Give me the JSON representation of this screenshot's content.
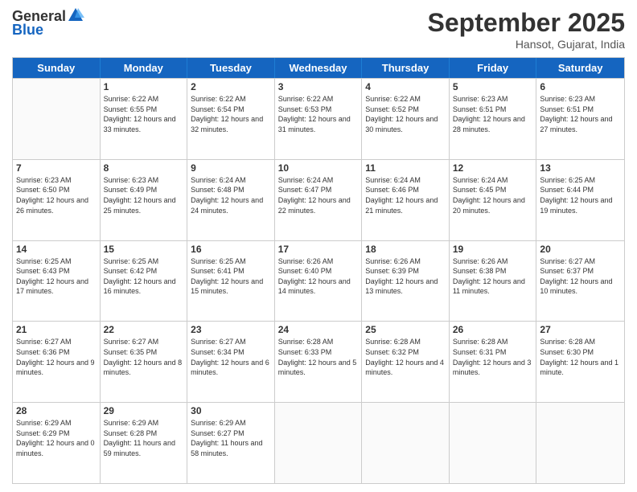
{
  "logo": {
    "general": "General",
    "blue": "Blue"
  },
  "header": {
    "month": "September 2025",
    "location": "Hansot, Gujarat, India"
  },
  "days": [
    "Sunday",
    "Monday",
    "Tuesday",
    "Wednesday",
    "Thursday",
    "Friday",
    "Saturday"
  ],
  "weeks": [
    [
      {
        "day": "",
        "sunrise": "",
        "sunset": "",
        "daylight": ""
      },
      {
        "day": "1",
        "sunrise": "Sunrise: 6:22 AM",
        "sunset": "Sunset: 6:55 PM",
        "daylight": "Daylight: 12 hours and 33 minutes."
      },
      {
        "day": "2",
        "sunrise": "Sunrise: 6:22 AM",
        "sunset": "Sunset: 6:54 PM",
        "daylight": "Daylight: 12 hours and 32 minutes."
      },
      {
        "day": "3",
        "sunrise": "Sunrise: 6:22 AM",
        "sunset": "Sunset: 6:53 PM",
        "daylight": "Daylight: 12 hours and 31 minutes."
      },
      {
        "day": "4",
        "sunrise": "Sunrise: 6:22 AM",
        "sunset": "Sunset: 6:52 PM",
        "daylight": "Daylight: 12 hours and 30 minutes."
      },
      {
        "day": "5",
        "sunrise": "Sunrise: 6:23 AM",
        "sunset": "Sunset: 6:51 PM",
        "daylight": "Daylight: 12 hours and 28 minutes."
      },
      {
        "day": "6",
        "sunrise": "Sunrise: 6:23 AM",
        "sunset": "Sunset: 6:51 PM",
        "daylight": "Daylight: 12 hours and 27 minutes."
      }
    ],
    [
      {
        "day": "7",
        "sunrise": "Sunrise: 6:23 AM",
        "sunset": "Sunset: 6:50 PM",
        "daylight": "Daylight: 12 hours and 26 minutes."
      },
      {
        "day": "8",
        "sunrise": "Sunrise: 6:23 AM",
        "sunset": "Sunset: 6:49 PM",
        "daylight": "Daylight: 12 hours and 25 minutes."
      },
      {
        "day": "9",
        "sunrise": "Sunrise: 6:24 AM",
        "sunset": "Sunset: 6:48 PM",
        "daylight": "Daylight: 12 hours and 24 minutes."
      },
      {
        "day": "10",
        "sunrise": "Sunrise: 6:24 AM",
        "sunset": "Sunset: 6:47 PM",
        "daylight": "Daylight: 12 hours and 22 minutes."
      },
      {
        "day": "11",
        "sunrise": "Sunrise: 6:24 AM",
        "sunset": "Sunset: 6:46 PM",
        "daylight": "Daylight: 12 hours and 21 minutes."
      },
      {
        "day": "12",
        "sunrise": "Sunrise: 6:24 AM",
        "sunset": "Sunset: 6:45 PM",
        "daylight": "Daylight: 12 hours and 20 minutes."
      },
      {
        "day": "13",
        "sunrise": "Sunrise: 6:25 AM",
        "sunset": "Sunset: 6:44 PM",
        "daylight": "Daylight: 12 hours and 19 minutes."
      }
    ],
    [
      {
        "day": "14",
        "sunrise": "Sunrise: 6:25 AM",
        "sunset": "Sunset: 6:43 PM",
        "daylight": "Daylight: 12 hours and 17 minutes."
      },
      {
        "day": "15",
        "sunrise": "Sunrise: 6:25 AM",
        "sunset": "Sunset: 6:42 PM",
        "daylight": "Daylight: 12 hours and 16 minutes."
      },
      {
        "day": "16",
        "sunrise": "Sunrise: 6:25 AM",
        "sunset": "Sunset: 6:41 PM",
        "daylight": "Daylight: 12 hours and 15 minutes."
      },
      {
        "day": "17",
        "sunrise": "Sunrise: 6:26 AM",
        "sunset": "Sunset: 6:40 PM",
        "daylight": "Daylight: 12 hours and 14 minutes."
      },
      {
        "day": "18",
        "sunrise": "Sunrise: 6:26 AM",
        "sunset": "Sunset: 6:39 PM",
        "daylight": "Daylight: 12 hours and 13 minutes."
      },
      {
        "day": "19",
        "sunrise": "Sunrise: 6:26 AM",
        "sunset": "Sunset: 6:38 PM",
        "daylight": "Daylight: 12 hours and 11 minutes."
      },
      {
        "day": "20",
        "sunrise": "Sunrise: 6:27 AM",
        "sunset": "Sunset: 6:37 PM",
        "daylight": "Daylight: 12 hours and 10 minutes."
      }
    ],
    [
      {
        "day": "21",
        "sunrise": "Sunrise: 6:27 AM",
        "sunset": "Sunset: 6:36 PM",
        "daylight": "Daylight: 12 hours and 9 minutes."
      },
      {
        "day": "22",
        "sunrise": "Sunrise: 6:27 AM",
        "sunset": "Sunset: 6:35 PM",
        "daylight": "Daylight: 12 hours and 8 minutes."
      },
      {
        "day": "23",
        "sunrise": "Sunrise: 6:27 AM",
        "sunset": "Sunset: 6:34 PM",
        "daylight": "Daylight: 12 hours and 6 minutes."
      },
      {
        "day": "24",
        "sunrise": "Sunrise: 6:28 AM",
        "sunset": "Sunset: 6:33 PM",
        "daylight": "Daylight: 12 hours and 5 minutes."
      },
      {
        "day": "25",
        "sunrise": "Sunrise: 6:28 AM",
        "sunset": "Sunset: 6:32 PM",
        "daylight": "Daylight: 12 hours and 4 minutes."
      },
      {
        "day": "26",
        "sunrise": "Sunrise: 6:28 AM",
        "sunset": "Sunset: 6:31 PM",
        "daylight": "Daylight: 12 hours and 3 minutes."
      },
      {
        "day": "27",
        "sunrise": "Sunrise: 6:28 AM",
        "sunset": "Sunset: 6:30 PM",
        "daylight": "Daylight: 12 hours and 1 minute."
      }
    ],
    [
      {
        "day": "28",
        "sunrise": "Sunrise: 6:29 AM",
        "sunset": "Sunset: 6:29 PM",
        "daylight": "Daylight: 12 hours and 0 minutes."
      },
      {
        "day": "29",
        "sunrise": "Sunrise: 6:29 AM",
        "sunset": "Sunset: 6:28 PM",
        "daylight": "Daylight: 11 hours and 59 minutes."
      },
      {
        "day": "30",
        "sunrise": "Sunrise: 6:29 AM",
        "sunset": "Sunset: 6:27 PM",
        "daylight": "Daylight: 11 hours and 58 minutes."
      },
      {
        "day": "",
        "sunrise": "",
        "sunset": "",
        "daylight": ""
      },
      {
        "day": "",
        "sunrise": "",
        "sunset": "",
        "daylight": ""
      },
      {
        "day": "",
        "sunrise": "",
        "sunset": "",
        "daylight": ""
      },
      {
        "day": "",
        "sunrise": "",
        "sunset": "",
        "daylight": ""
      }
    ]
  ]
}
